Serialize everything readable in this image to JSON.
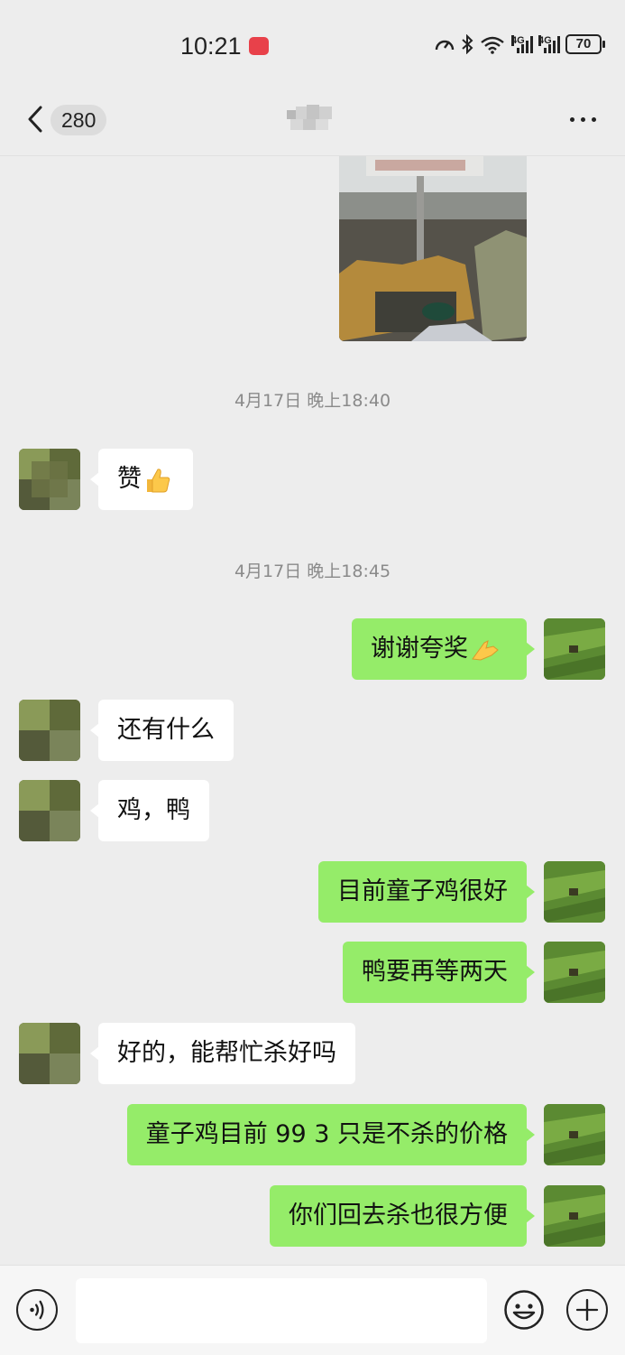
{
  "status_bar": {
    "time": "10:21",
    "network_label_1": "4G",
    "network_label_2": "4G",
    "battery": "70"
  },
  "header": {
    "unread_count": "280"
  },
  "messages": {
    "timestamp_1": "4月17日 晚上18:40",
    "timestamp_2": "4月17日 晚上18:45",
    "m1": "赞",
    "m2": "谢谢夸奖",
    "m3": "还有什么",
    "m4": "鸡，鸭",
    "m5": "目前童子鸡很好",
    "m6": "鸭要再等两天",
    "m7": "好的，能帮忙杀好吗",
    "m8": "童子鸡目前 99 3 只是不杀的价格",
    "m9": "你们回去杀也很方便"
  },
  "colors": {
    "sent_bubble": "#95ec69",
    "received_bubble": "#ffffff",
    "background": "#ededed"
  },
  "icons": {
    "back": "chevron-left-icon",
    "more": "more-dots-icon",
    "voice": "voice-icon",
    "emoji": "smiley-icon",
    "plus": "plus-icon",
    "thumbs_up": "thumbs-up-icon",
    "ok_hand": "ok-hand-icon"
  }
}
